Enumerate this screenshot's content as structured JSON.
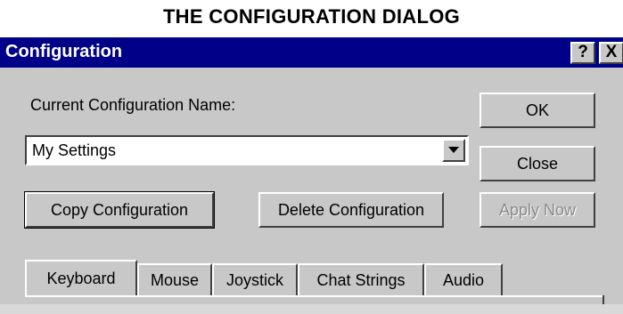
{
  "heading": "THE CONFIGURATION DIALOG",
  "window": {
    "title": "Configuration",
    "help_button": "?",
    "close_button": "X"
  },
  "config_name_label": "Current Configuration Name:",
  "config_select": {
    "value": "My Settings"
  },
  "buttons": {
    "ok": "OK",
    "close": "Close",
    "copy": "Copy Configuration",
    "delete": "Delete Configuration",
    "apply": "Apply Now"
  },
  "tabs": [
    "Keyboard",
    "Mouse",
    "Joystick",
    "Chat Strings",
    "Audio"
  ],
  "colors": {
    "titlebar": "#000088",
    "face": "#c8c8c8"
  }
}
